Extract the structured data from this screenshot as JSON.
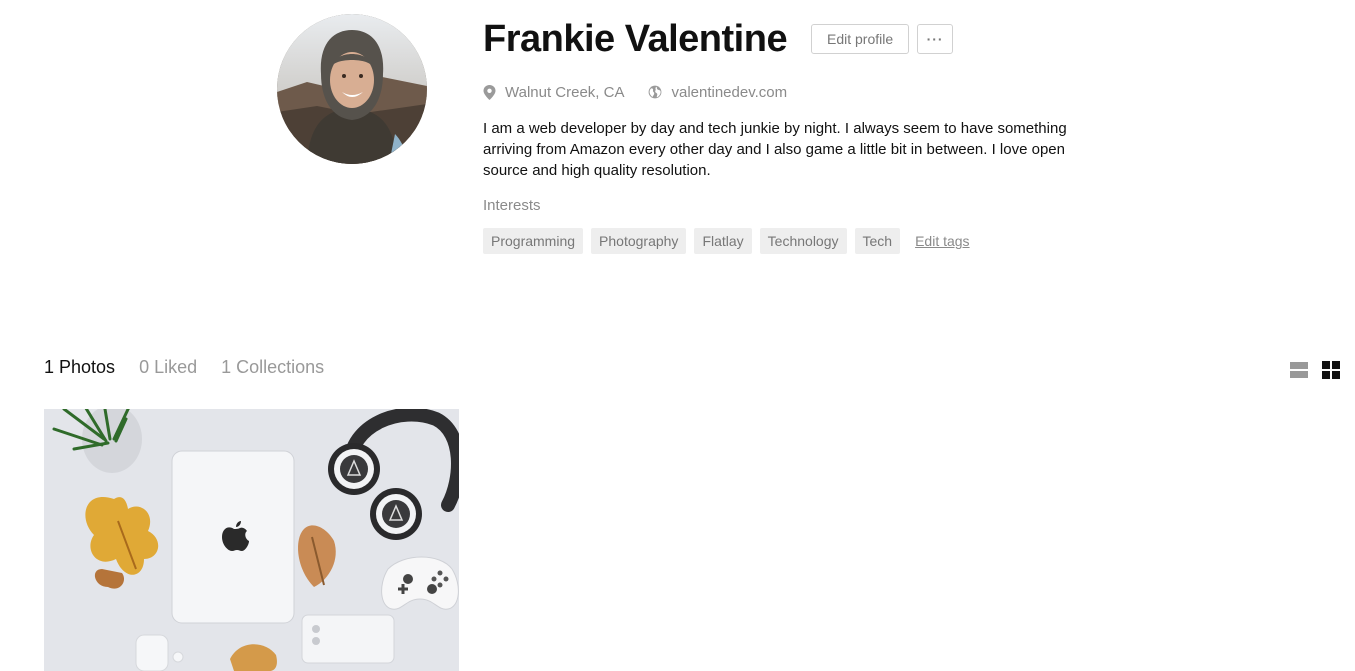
{
  "profile": {
    "name": "Frankie Valentine",
    "edit_profile_label": "Edit profile",
    "more_label": "···",
    "location": "Walnut Creek, CA",
    "website": "valentinedev.com",
    "bio": "I am a web developer by day and tech junkie by night. I always seem to have something arriving from Amazon every other day and I also game a little bit in between. I love open source and high quality resolution.",
    "interests_label": "Interests",
    "tags": [
      "Programming",
      "Photography",
      "Flatlay",
      "Technology",
      "Tech"
    ],
    "edit_tags_label": "Edit tags"
  },
  "tabs": [
    {
      "count": "1",
      "label": "Photos",
      "active": true
    },
    {
      "count": "0",
      "label": "Liked",
      "active": false
    },
    {
      "count": "1",
      "label": "Collections",
      "active": false
    }
  ],
  "view_toggle": {
    "options": [
      "list-view-icon",
      "grid-view-icon"
    ],
    "selected": "grid-view-icon"
  },
  "icons": {
    "location": "map-pin-icon",
    "website": "globe-icon"
  },
  "colors": {
    "text": "#111111",
    "muted": "#8a8a8a",
    "tag_bg": "#eeeeee",
    "border": "#d1d1d1"
  }
}
